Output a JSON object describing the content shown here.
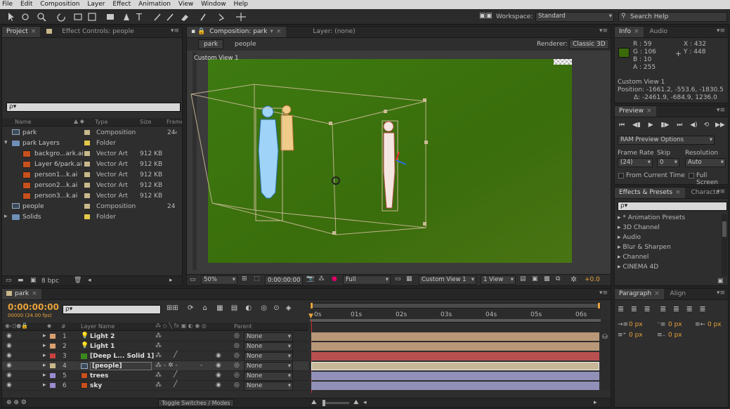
{
  "menu": [
    "File",
    "Edit",
    "Composition",
    "Layer",
    "Effect",
    "Animation",
    "View",
    "Window",
    "Help"
  ],
  "toolbar": {
    "workspace_label": "Workspace:",
    "workspace_value": "Standard",
    "search_placeholder": "Search Help"
  },
  "project": {
    "tabs": {
      "project": "Project",
      "effect_controls": "Effect Controls: people"
    },
    "search": "ρ▾",
    "columns": {
      "name": "Name",
      "type": "Type",
      "size": "Size",
      "frame": "Frame"
    },
    "items": [
      {
        "name": "park",
        "type": "Composition",
        "size": "",
        "frame": "24",
        "color": "#c9b88a"
      },
      {
        "name": "park Layers",
        "type": "Folder",
        "size": "",
        "frame": "",
        "color": "#e5c84a"
      },
      {
        "name": "backgro...ark.ai",
        "type": "Vector Art",
        "size": "912 KB",
        "frame": "",
        "color": "#c9b88a"
      },
      {
        "name": "Layer 6/park.ai",
        "type": "Vector Art",
        "size": "912 KB",
        "frame": "",
        "color": "#c9b88a"
      },
      {
        "name": "person1...k.ai",
        "type": "Vector Art",
        "size": "912 KB",
        "frame": "",
        "color": "#c9b88a"
      },
      {
        "name": "person2...k.ai",
        "type": "Vector Art",
        "size": "912 KB",
        "frame": "",
        "color": "#c9b88a"
      },
      {
        "name": "person3...k.ai",
        "type": "Vector Art",
        "size": "912 KB",
        "frame": "",
        "color": "#c9b88a"
      },
      {
        "name": "people",
        "type": "Composition",
        "size": "",
        "frame": "24",
        "color": "#c9b88a"
      },
      {
        "name": "Solids",
        "type": "Folder",
        "size": "",
        "frame": "",
        "color": "#e5c84a"
      }
    ],
    "bpc": "8 bpc"
  },
  "comp": {
    "tabs": {
      "composition": "Composition: park",
      "layer": "Layer: (none)"
    },
    "crumbs": [
      "park",
      "people"
    ],
    "renderer_label": "Renderer:",
    "renderer_value": "Classic 3D",
    "view_name": "Custom View 1",
    "zoom": "50%",
    "timecode": "0:00:00:00",
    "resolution": "Full",
    "view": "Custom View 1",
    "views": "1 View",
    "exposure": "+0.0"
  },
  "info": {
    "tabs": {
      "info": "Info",
      "audio": "Audio"
    },
    "r": "R : 59",
    "g": "G : 106",
    "b": "B : 10",
    "a": "A : 255",
    "x": "X : 432",
    "y": "Y : 448",
    "swatch": "#3b6a0a",
    "view": "Custom View 1",
    "position": "Position: -1661.2, -553.6, -1830.5",
    "delta": "Δ: -2461.9, -684.9, 1236.0"
  },
  "preview": {
    "tab": "Preview",
    "ram_options": "RAM Preview Options",
    "frame_rate_label": "Frame Rate",
    "skip_label": "Skip",
    "resolution_label": "Resolution",
    "frame_rate": "(24)",
    "skip": "0",
    "resolution": "Auto",
    "from_current": "From Current Time",
    "full_screen": "Full Screen"
  },
  "effects": {
    "tabs": {
      "effects": "Effects & Presets",
      "character": "Characte"
    },
    "search": "ρ▾",
    "items": [
      "* Animation Presets",
      "3D Channel",
      "Audio",
      "Blur & Sharpen",
      "Channel",
      "CINEMA 4D"
    ]
  },
  "paragraph": {
    "tabs": {
      "paragraph": "Paragraph",
      "align": "Align"
    },
    "px": "0 px"
  },
  "timeline": {
    "tab": "park",
    "timecode": "0:00:00:00",
    "fps": "00000 (24.00 fps)",
    "search": "ρ▾",
    "col_num": "#",
    "col_layer": "Layer Name",
    "col_parent": "Parent",
    "toggle": "Toggle Switches / Modes",
    "ruler": [
      "0s",
      "01s",
      "02s",
      "03s",
      "04s",
      "05s",
      "06s"
    ],
    "layers": [
      {
        "num": "1",
        "name": "Light 2",
        "parent": "None",
        "color": "#d8a070",
        "bar": "#b89878"
      },
      {
        "num": "2",
        "name": "Light 1",
        "parent": "None",
        "color": "#d8a070",
        "bar": "#b89878"
      },
      {
        "num": "3",
        "name": "[Deep L... Solid 1]",
        "parent": "None",
        "color": "#c84040",
        "bar": "#b85050"
      },
      {
        "num": "4",
        "name": "[people]",
        "parent": "None",
        "color": "#c9b88a",
        "bar": "#c8b898"
      },
      {
        "num": "5",
        "name": "trees",
        "parent": "None",
        "color": "#9a8ad0",
        "bar": "#9090b8"
      },
      {
        "num": "6",
        "name": "sky",
        "parent": "None",
        "color": "#9a8ad0",
        "bar": "#9090b8"
      }
    ]
  }
}
